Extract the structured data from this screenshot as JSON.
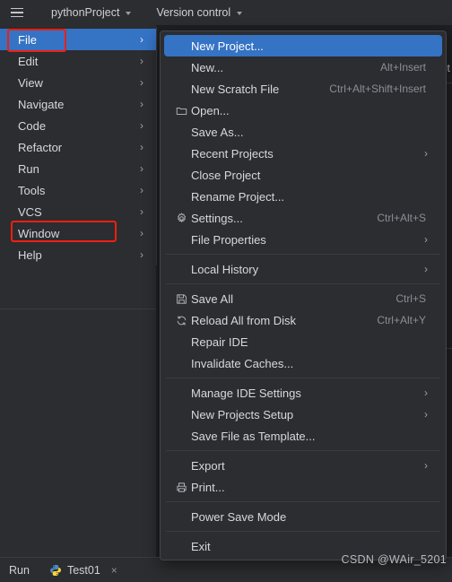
{
  "topbar": {
    "menu_icon": "hamburger-icon",
    "project_name": "pythonProject",
    "version_control": "Version control"
  },
  "main_menu": {
    "items": [
      {
        "label": "File",
        "selected": true,
        "arrow": "›"
      },
      {
        "label": "Edit",
        "selected": false,
        "arrow": "›"
      },
      {
        "label": "View",
        "selected": false,
        "arrow": "›"
      },
      {
        "label": "Navigate",
        "selected": false,
        "arrow": "›"
      },
      {
        "label": "Code",
        "selected": false,
        "arrow": "›"
      },
      {
        "label": "Refactor",
        "selected": false,
        "arrow": "›"
      },
      {
        "label": "Run",
        "selected": false,
        "arrow": "›"
      },
      {
        "label": "Tools",
        "selected": false,
        "arrow": "›"
      },
      {
        "label": "VCS",
        "selected": false,
        "arrow": "›"
      },
      {
        "label": "Window",
        "selected": false,
        "arrow": "›"
      },
      {
        "label": "Help",
        "selected": false,
        "arrow": "›"
      }
    ]
  },
  "file_menu": {
    "items": [
      {
        "type": "item",
        "label": "New Project...",
        "shortcut": "",
        "icon": "",
        "arrow": false,
        "selected": true
      },
      {
        "type": "item",
        "label": "New...",
        "shortcut": "Alt+Insert",
        "icon": "",
        "arrow": false,
        "selected": false
      },
      {
        "type": "item",
        "label": "New Scratch File",
        "shortcut": "Ctrl+Alt+Shift+Insert",
        "icon": "",
        "arrow": false,
        "selected": false
      },
      {
        "type": "item",
        "label": "Open...",
        "shortcut": "",
        "icon": "folder-icon",
        "arrow": false,
        "selected": false
      },
      {
        "type": "item",
        "label": "Save As...",
        "shortcut": "",
        "icon": "",
        "arrow": false,
        "selected": false
      },
      {
        "type": "item",
        "label": "Recent Projects",
        "shortcut": "",
        "icon": "",
        "arrow": true,
        "selected": false
      },
      {
        "type": "item",
        "label": "Close Project",
        "shortcut": "",
        "icon": "",
        "arrow": false,
        "selected": false
      },
      {
        "type": "item",
        "label": "Rename Project...",
        "shortcut": "",
        "icon": "",
        "arrow": false,
        "selected": false
      },
      {
        "type": "item",
        "label": "Settings...",
        "shortcut": "Ctrl+Alt+S",
        "icon": "gear-icon",
        "arrow": false,
        "selected": false
      },
      {
        "type": "item",
        "label": "File Properties",
        "shortcut": "",
        "icon": "",
        "arrow": true,
        "selected": false
      },
      {
        "type": "separator"
      },
      {
        "type": "item",
        "label": "Local History",
        "shortcut": "",
        "icon": "",
        "arrow": true,
        "selected": false
      },
      {
        "type": "separator"
      },
      {
        "type": "item",
        "label": "Save All",
        "shortcut": "Ctrl+S",
        "icon": "save-icon",
        "arrow": false,
        "selected": false
      },
      {
        "type": "item",
        "label": "Reload All from Disk",
        "shortcut": "Ctrl+Alt+Y",
        "icon": "refresh-icon",
        "arrow": false,
        "selected": false
      },
      {
        "type": "item",
        "label": "Repair IDE",
        "shortcut": "",
        "icon": "",
        "arrow": false,
        "selected": false
      },
      {
        "type": "item",
        "label": "Invalidate Caches...",
        "shortcut": "",
        "icon": "",
        "arrow": false,
        "selected": false
      },
      {
        "type": "separator"
      },
      {
        "type": "item",
        "label": "Manage IDE Settings",
        "shortcut": "",
        "icon": "",
        "arrow": true,
        "selected": false
      },
      {
        "type": "item",
        "label": "New Projects Setup",
        "shortcut": "",
        "icon": "",
        "arrow": true,
        "selected": false
      },
      {
        "type": "item",
        "label": "Save File as Template...",
        "shortcut": "",
        "icon": "",
        "arrow": false,
        "selected": false
      },
      {
        "type": "separator"
      },
      {
        "type": "item",
        "label": "Export",
        "shortcut": "",
        "icon": "",
        "arrow": true,
        "selected": false
      },
      {
        "type": "item",
        "label": "Print...",
        "shortcut": "",
        "icon": "printer-icon",
        "arrow": false,
        "selected": false
      },
      {
        "type": "separator"
      },
      {
        "type": "item",
        "label": "Power Save Mode",
        "shortcut": "",
        "icon": "",
        "arrow": false,
        "selected": false
      },
      {
        "type": "separator"
      },
      {
        "type": "item",
        "label": "Exit",
        "shortcut": "",
        "icon": "",
        "arrow": false,
        "selected": false
      }
    ]
  },
  "editor": {
    "clipped_text": "st"
  },
  "run_bar": {
    "run_label": "Run",
    "tab_label": "Test01",
    "close_label": "×"
  },
  "watermark": "CSDN @WAir_5201",
  "colors": {
    "background": "#2b2d30",
    "editor_background": "#1e1f22",
    "accent_selection": "#3573c4",
    "highlight_box": "#f01f12",
    "text": "#d6d8dd",
    "muted_text": "#8a8e95",
    "separator": "#393b40"
  }
}
